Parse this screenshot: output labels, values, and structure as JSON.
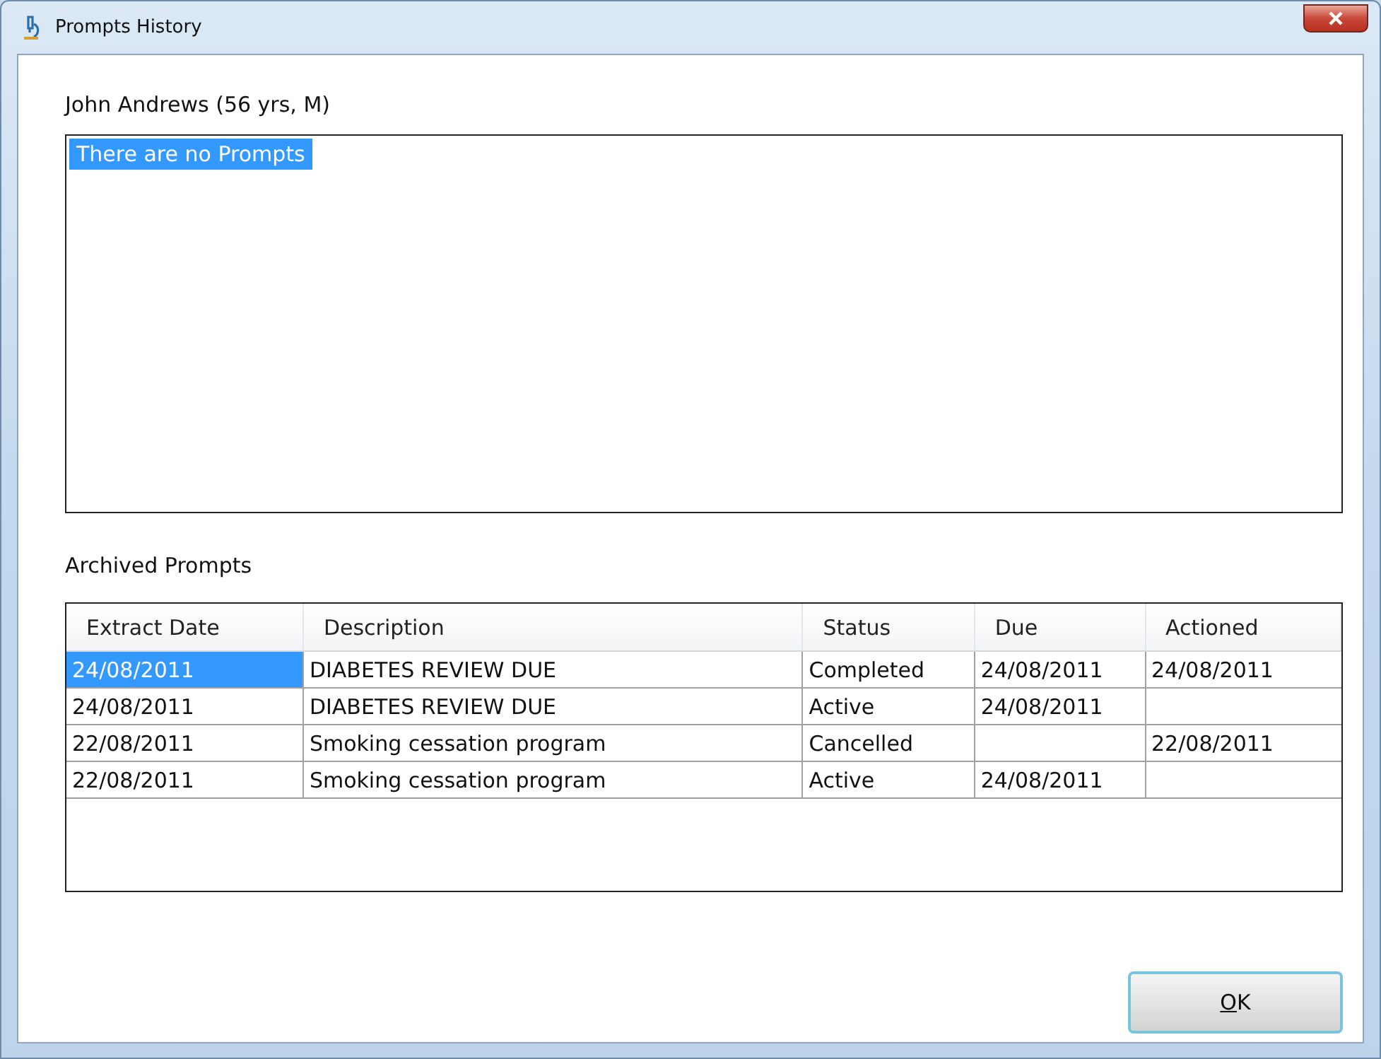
{
  "window": {
    "title": "Prompts History"
  },
  "patient": "John Andrews (56 yrs, M)",
  "prompts_list": {
    "items": [
      {
        "text": "There are no Prompts",
        "selected": true
      }
    ]
  },
  "archived": {
    "label": "Archived Prompts",
    "columns": [
      "Extract Date",
      "Description",
      "Status",
      "Due",
      "Actioned"
    ],
    "rows": [
      {
        "selected": true,
        "cells": [
          "24/08/2011",
          "DIABETES REVIEW DUE",
          "Completed",
          "24/08/2011",
          "24/08/2011"
        ]
      },
      {
        "selected": false,
        "cells": [
          "24/08/2011",
          "DIABETES REVIEW DUE",
          "Active",
          "24/08/2011",
          null
        ]
      },
      {
        "selected": false,
        "cells": [
          "22/08/2011",
          "Smoking cessation program",
          "Cancelled",
          null,
          "22/08/2011"
        ]
      },
      {
        "selected": false,
        "cells": [
          "22/08/2011",
          "Smoking cessation program",
          "Active",
          "24/08/2011",
          null
        ]
      }
    ]
  },
  "ok_button": {
    "access_key": "O",
    "rest": "K"
  }
}
